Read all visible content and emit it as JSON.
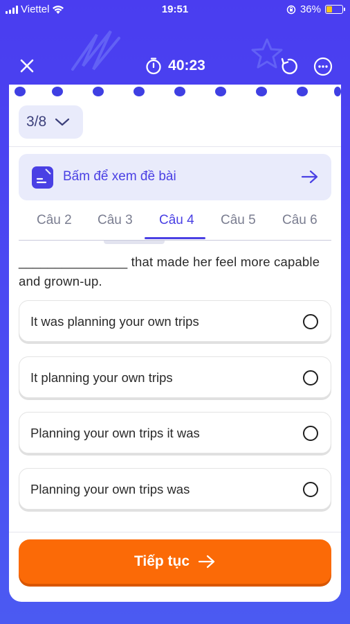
{
  "status_bar": {
    "carrier": "Viettel",
    "time": "19:51",
    "battery_percent": "36%",
    "battery_level": 0.36
  },
  "header": {
    "timer": "40:23",
    "icons": [
      "close-icon",
      "stopwatch-icon",
      "reset-icon",
      "more-icon"
    ]
  },
  "question_selector": {
    "value": "3/8"
  },
  "view_prompt": {
    "label": "Bấm để xem đề bài"
  },
  "tabs": [
    {
      "label": "Câu 2",
      "active": false
    },
    {
      "label": "Câu 3",
      "active": false
    },
    {
      "label": "Câu 4",
      "active": true
    },
    {
      "label": "Câu 5",
      "active": false
    },
    {
      "label": "Câu 6",
      "active": false
    }
  ],
  "question": {
    "text": "_______________ that made her feel more capable and grown-up."
  },
  "options": [
    {
      "label": "It was planning your own trips"
    },
    {
      "label": "It planning your own trips"
    },
    {
      "label": "Planning your own trips it was"
    },
    {
      "label": "Planning your own trips was"
    }
  ],
  "continue_button": {
    "label": "Tiếp tục"
  },
  "colors": {
    "accent": "#4a40e4",
    "background": "#4a3df0",
    "continue": "#fb6a07",
    "card": "#ffffff"
  }
}
